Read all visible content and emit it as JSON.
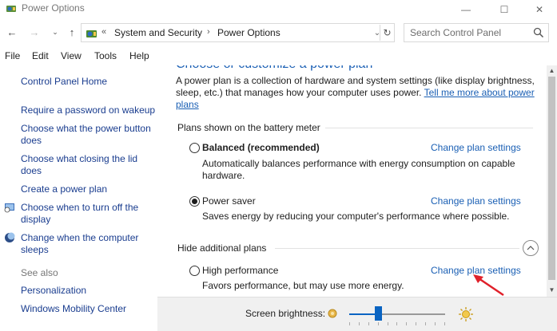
{
  "window": {
    "title": "Power Options",
    "minimize_glyph": "—",
    "maximize_glyph": "☐",
    "close_glyph": "✕"
  },
  "nav": {
    "back_glyph": "←",
    "forward_glyph": "→",
    "recent_glyph": "⌄",
    "up_glyph": "↑",
    "overflow_glyph": "«",
    "breadcrumbs": [
      "System and Security",
      "Power Options"
    ],
    "crumb_separator": "›",
    "dropdown_glyph": "⌄",
    "refresh_glyph": "↻",
    "search_placeholder": "Search Control Panel"
  },
  "menu": [
    "File",
    "Edit",
    "View",
    "Tools",
    "Help"
  ],
  "left_nav": {
    "home": "Control Panel Home",
    "links": [
      "Require a password on wakeup",
      "Choose what the power button does",
      "Choose what closing the lid does",
      "Create a power plan",
      "Choose when to turn off the display",
      "Change when the computer sleeps"
    ],
    "see_also_label": "See also",
    "see_also": [
      "Personalization",
      "Windows Mobility Center"
    ]
  },
  "main": {
    "heading": "Choose or customize a power plan",
    "intro": "A power plan is a collection of hardware and system settings (like display brightness, sleep, etc.) that manages how your computer uses power.",
    "intro_link": "Tell me more about power plans",
    "battery_group": "Plans shown on the battery meter",
    "hidden_group": "Hide additional plans",
    "plans": [
      {
        "name": "Balanced (recommended)",
        "description": "Automatically balances performance with energy consumption on capable hardware.",
        "link": "Change plan settings",
        "selected": false
      },
      {
        "name": "Power saver",
        "description": "Saves energy by reducing your computer's performance where possible.",
        "link": "Change plan settings",
        "selected": true
      },
      {
        "name": "High performance",
        "description": "Favors performance, but may use more energy.",
        "link": "Change plan settings",
        "selected": false
      }
    ]
  },
  "brightness": {
    "label": "Screen brightness:",
    "level": 0.3
  },
  "colors": {
    "link": "#1a3d8f",
    "heading": "#1a5fb4",
    "slider": "#0a64c2",
    "annotation": "#e0202a"
  }
}
